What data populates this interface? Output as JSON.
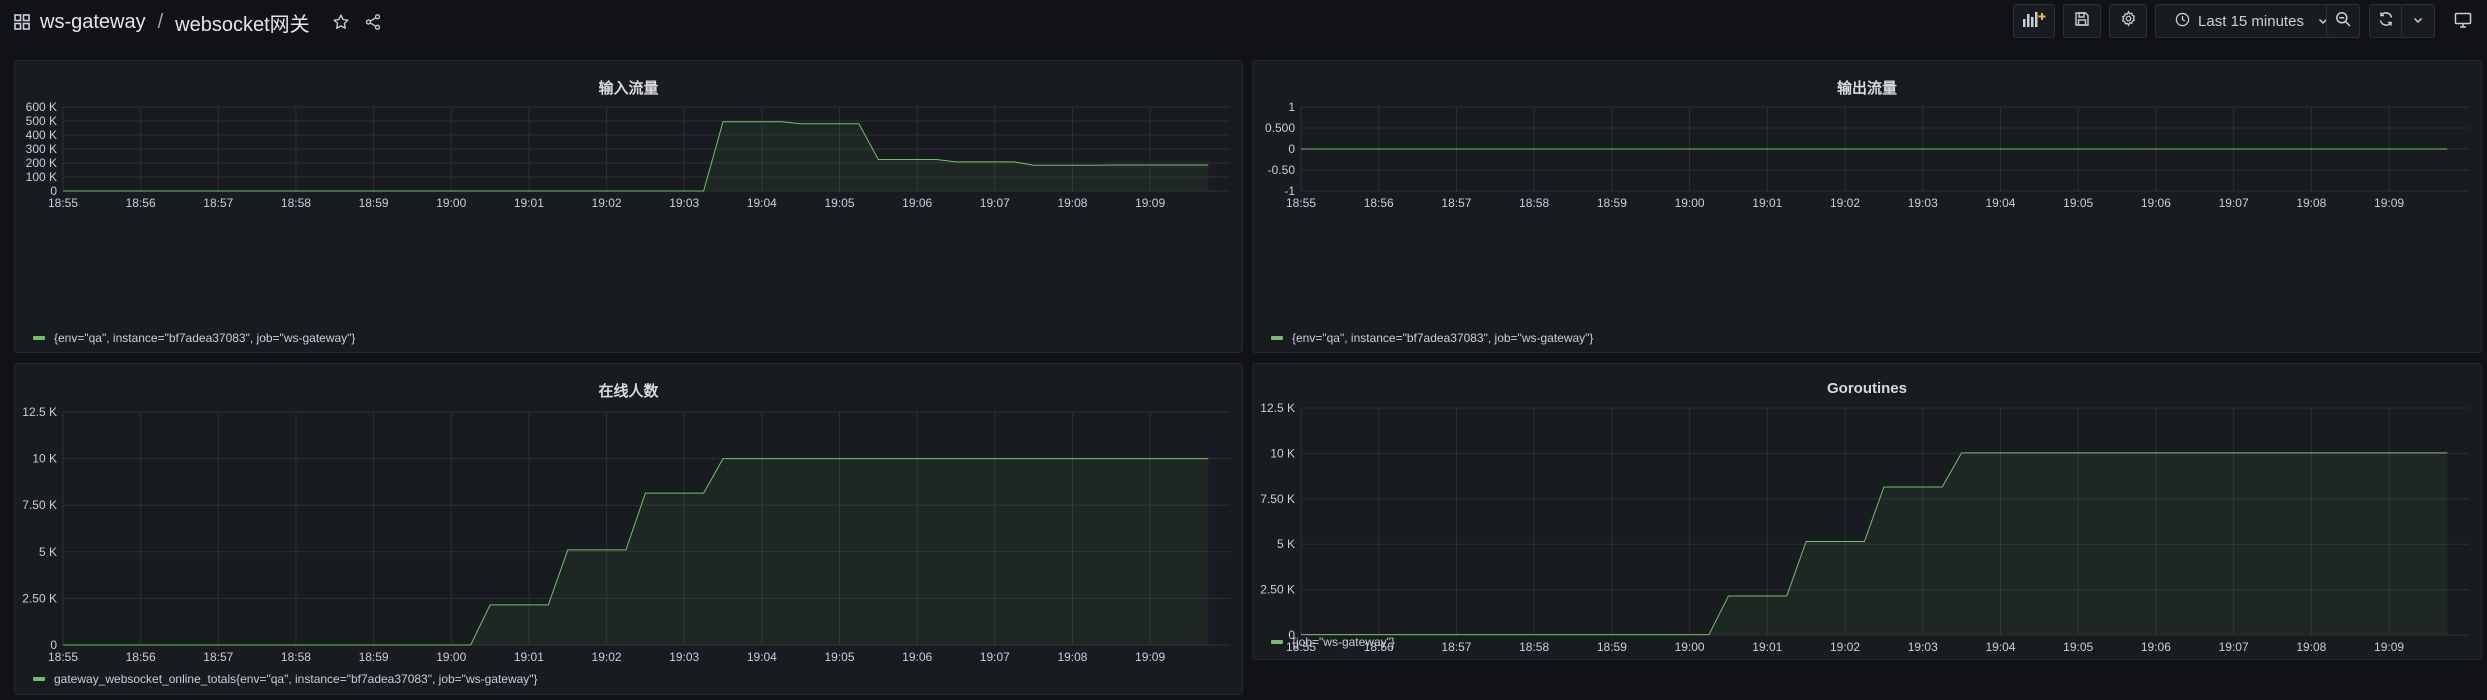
{
  "breadcrumb": {
    "folder": "ws-gateway",
    "separator": "/",
    "dashboard": "websocket网关"
  },
  "toolbar": {
    "time_range": "Last 15 minutes"
  },
  "colors": {
    "series": "#73bf69",
    "grid": "#2c2f35",
    "axis_text": "#ccccdc",
    "background": "#181b1f"
  },
  "panels": [
    {
      "title": "输入流量",
      "legend": "{env=\"qa\", instance=\"bf7adea37083\", job=\"ws-gateway\"}",
      "chart_data": {
        "type": "area",
        "y_ticks": [
          "0",
          "100 K",
          "200 K",
          "300 K",
          "400 K",
          "500 K",
          "600 K"
        ],
        "ylim": [
          0,
          600000
        ],
        "x_ticks": [
          "18:55",
          "18:56",
          "18:57",
          "18:58",
          "18:59",
          "19:00",
          "19:01",
          "19:02",
          "19:03",
          "19:04",
          "19:05",
          "19:06",
          "19:07",
          "19:08",
          "19:09"
        ],
        "series": [
          {
            "name": "{env=\"qa\", instance=\"bf7adea37083\", job=\"ws-gateway\"}",
            "points": [
              [
                "18:55",
                0
              ],
              [
                "19:03:15",
                0
              ],
              [
                "19:03:30",
                495000
              ],
              [
                "19:04:15",
                495000
              ],
              [
                "19:04:30",
                480000
              ],
              [
                "19:05:15",
                480000
              ],
              [
                "19:05:30",
                225000
              ],
              [
                "19:06:15",
                225000
              ],
              [
                "19:06:30",
                208000
              ],
              [
                "19:07:15",
                208000
              ],
              [
                "19:07:30",
                184000
              ],
              [
                "19:08:15",
                184000
              ],
              [
                "19:08:30",
                186000
              ],
              [
                "19:09:45",
                186000
              ]
            ]
          }
        ]
      }
    },
    {
      "title": "输出流量",
      "legend": "{env=\"qa\", instance=\"bf7adea37083\", job=\"ws-gateway\"}",
      "chart_data": {
        "type": "line",
        "y_ticks": [
          "-1",
          "-0.50",
          "0",
          "0.500",
          "1"
        ],
        "ylim": [
          -1,
          1
        ],
        "x_ticks": [
          "18:55",
          "18:56",
          "18:57",
          "18:58",
          "18:59",
          "19:00",
          "19:01",
          "19:02",
          "19:03",
          "19:04",
          "19:05",
          "19:06",
          "19:07",
          "19:08",
          "19:09"
        ],
        "series": [
          {
            "name": "{env=\"qa\", instance=\"bf7adea37083\", job=\"ws-gateway\"}",
            "points": [
              [
                "18:55",
                0
              ],
              [
                "19:09:45",
                0
              ]
            ]
          }
        ]
      }
    },
    {
      "title": "在线人数",
      "legend": "gateway_websocket_online_totals{env=\"qa\", instance=\"bf7adea37083\", job=\"ws-gateway\"}",
      "chart_data": {
        "type": "area",
        "y_ticks": [
          "0",
          "2.50 K",
          "5 K",
          "7.50 K",
          "10 K",
          "12.5 K"
        ],
        "ylim": [
          0,
          12500
        ],
        "x_ticks": [
          "18:55",
          "18:56",
          "18:57",
          "18:58",
          "18:59",
          "19:00",
          "19:01",
          "19:02",
          "19:03",
          "19:04",
          "19:05",
          "19:06",
          "19:07",
          "19:08",
          "19:09"
        ],
        "series": [
          {
            "name": "gateway_websocket_online_totals{env=\"qa\", instance=\"bf7adea37083\", job=\"ws-gateway\"}",
            "points": [
              [
                "18:55",
                0
              ],
              [
                "19:00:15",
                0
              ],
              [
                "19:00:30",
                2150
              ],
              [
                "19:01:15",
                2150
              ],
              [
                "19:01:30",
                5100
              ],
              [
                "19:02:15",
                5100
              ],
              [
                "19:02:30",
                8150
              ],
              [
                "19:03:15",
                8150
              ],
              [
                "19:03:30",
                10000
              ],
              [
                "19:09:45",
                10000
              ]
            ]
          }
        ]
      }
    },
    {
      "title": "Goroutines",
      "legend": "{job=\"ws-gateway\"}",
      "chart_data": {
        "type": "area",
        "y_ticks": [
          "0",
          "2.50 K",
          "5 K",
          "7.50 K",
          "10 K",
          "12.5 K"
        ],
        "ylim": [
          0,
          12500
        ],
        "x_ticks": [
          "18:55",
          "18:56",
          "18:57",
          "18:58",
          "18:59",
          "19:00",
          "19:01",
          "19:02",
          "19:03",
          "19:04",
          "19:05",
          "19:06",
          "19:07",
          "19:08",
          "19:09"
        ],
        "series": [
          {
            "name": "{job=\"ws-gateway\"}",
            "points": [
              [
                "18:55",
                20
              ],
              [
                "19:00:15",
                20
              ],
              [
                "19:00:30",
                2150
              ],
              [
                "19:01:15",
                2150
              ],
              [
                "19:01:30",
                5150
              ],
              [
                "19:02:15",
                5150
              ],
              [
                "19:02:30",
                8150
              ],
              [
                "19:03:15",
                8150
              ],
              [
                "19:03:30",
                10030
              ],
              [
                "19:09:45",
                10030
              ]
            ]
          }
        ]
      }
    }
  ]
}
